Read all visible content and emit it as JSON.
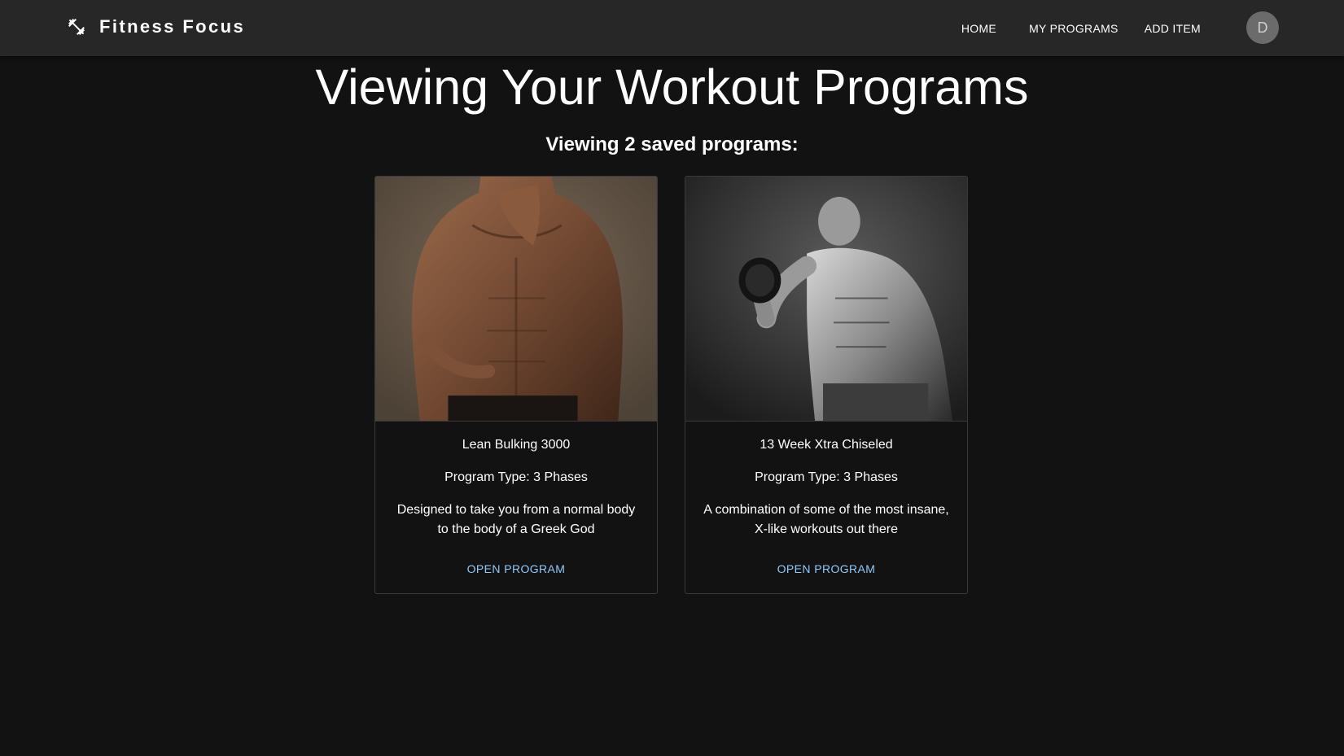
{
  "appbar": {
    "brand_icon": "dumbbell-icon",
    "title": "Fitness Focus",
    "nav": [
      "HOME",
      "MY PROGRAMS",
      "ADD ITEM"
    ],
    "avatar_initial": "D"
  },
  "main": {
    "title": "Viewing Your Workout Programs",
    "subtitle": "Viewing 2 saved programs:"
  },
  "programs": [
    {
      "name": "Lean Bulking 3000",
      "type": "Program Type: 3 Phases",
      "description": "Designed to take you from a normal body to the body of a Greek God",
      "action": "OPEN PROGRAM",
      "image": "shirtless muscular man torso photo (warm brown tones)"
    },
    {
      "name": "13 Week Xtra Chiseled",
      "type": "Program Type: 3 Phases",
      "description": "A combination of some of the most insane, X-like workouts out there",
      "action": "OPEN PROGRAM",
      "image": "black-and-white photo of muscular man curling a dumbbell"
    }
  ],
  "colors": {
    "background": "#121212",
    "appbar": "#272727",
    "accent_link": "#90caf9",
    "card_border": "#3a3a3a"
  }
}
